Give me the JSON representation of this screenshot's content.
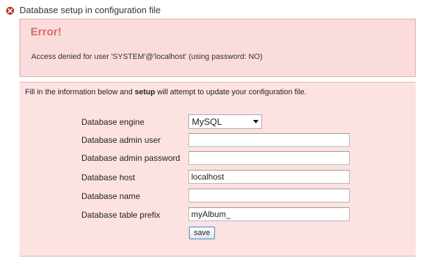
{
  "header": {
    "title": "Database setup in configuration file",
    "icon": "error-icon",
    "icon_color": "#c0392b"
  },
  "error": {
    "title": "Error!",
    "message": "Access denied for user 'SYSTEM'@'localhost' (using password: NO)",
    "title_color": "#d76b6b",
    "background": "#fbdcdc"
  },
  "setup": {
    "intro_before": "Fill in the information below and ",
    "intro_bold": "setup",
    "intro_after": " will attempt to update your configuration file.",
    "fields": {
      "engine": {
        "label": "Database engine",
        "value": "MySQL"
      },
      "admin_user": {
        "label": "Database admin user",
        "value": ""
      },
      "admin_password": {
        "label": "Database admin password",
        "value": ""
      },
      "host": {
        "label": "Database host",
        "value": "localhost"
      },
      "name": {
        "label": "Database name",
        "value": ""
      },
      "table_prefix": {
        "label": "Database table prefix",
        "value": "myAlbum_"
      }
    },
    "save_label": "save"
  }
}
